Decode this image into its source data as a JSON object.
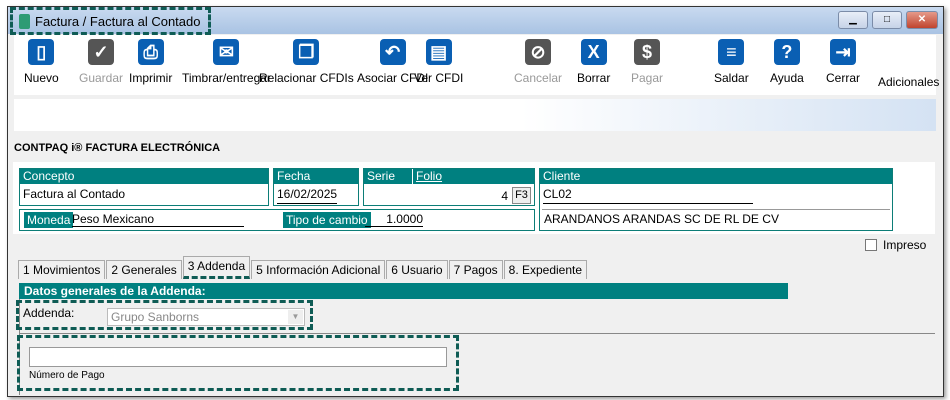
{
  "window": {
    "title": "Factura / Factura al Contado",
    "minimize": "▁",
    "maximize": "□",
    "close": "✕"
  },
  "toolbar": [
    {
      "label": "Nuevo",
      "icon": "new-document-icon",
      "glyph": "▯",
      "enabled": true
    },
    {
      "label": "Guardar",
      "icon": "checkmark-icon",
      "glyph": "✓",
      "enabled": false
    },
    {
      "label": "Imprimir",
      "icon": "printer-icon",
      "glyph": "⎙",
      "enabled": true
    },
    {
      "label": "Timbrar/entregar",
      "icon": "stamp-send-icon",
      "glyph": "✉",
      "enabled": true
    },
    {
      "label": "Relacionar CFDIs",
      "icon": "copy-documents-icon",
      "glyph": "❐",
      "enabled": true
    },
    {
      "label": "Asociar CFDI",
      "icon": "associate-icon",
      "glyph": "↶",
      "enabled": true
    },
    {
      "label": "Ver CFDI",
      "icon": "view-document-icon",
      "glyph": "▤",
      "enabled": true
    },
    {
      "label": "Cancelar",
      "icon": "cancel-icon",
      "glyph": "⊘",
      "enabled": false
    },
    {
      "label": "Borrar",
      "icon": "delete-icon",
      "glyph": "X",
      "enabled": true
    },
    {
      "label": "Pagar",
      "icon": "pay-icon",
      "glyph": "$",
      "enabled": false
    },
    {
      "label": "Saldar",
      "icon": "settle-icon",
      "glyph": "≡",
      "enabled": true
    },
    {
      "label": "Ayuda",
      "icon": "help-icon",
      "glyph": "?",
      "enabled": true
    },
    {
      "label": "Cerrar",
      "icon": "exit-door-icon",
      "glyph": "⇥",
      "enabled": true
    }
  ],
  "adicionales": "Adicionales",
  "app_name": "CONTPAQ i® FACTURA ELECTRÓNICA",
  "form": {
    "concepto_label": "Concepto",
    "concepto": "Factura al Contado",
    "fecha_label": "Fecha",
    "fecha": "16/02/2025",
    "serie_label": "Serie",
    "folio_label": "Folio",
    "folio": "4",
    "f3": "F3",
    "cliente_label": "Cliente",
    "cliente_code": "CL02",
    "cliente_name": "ARANDANOS ARANDAS SC DE RL DE CV",
    "moneda_label": "Moneda",
    "moneda": "Peso Mexicano",
    "tipo_cambio_label": "Tipo de cambio",
    "tipo_cambio": "1.0000",
    "impreso_label": "Impreso",
    "impreso_checked": false
  },
  "tabs": [
    "1 Movimientos",
    "2 Generales",
    "3 Addenda",
    "5 Información Adicional",
    "6 Usuario",
    "7 Pagos",
    "8. Expediente"
  ],
  "active_tab": "3 Addenda",
  "addenda": {
    "section_title": "Datos generales de la Addenda:",
    "label": "Addenda:",
    "selected": "Grupo Sanborns",
    "numero_pago_value": "",
    "numero_pago_label": "Número de Pago"
  },
  "colors": {
    "header": "#008080",
    "highlight": "#0f5c55"
  }
}
